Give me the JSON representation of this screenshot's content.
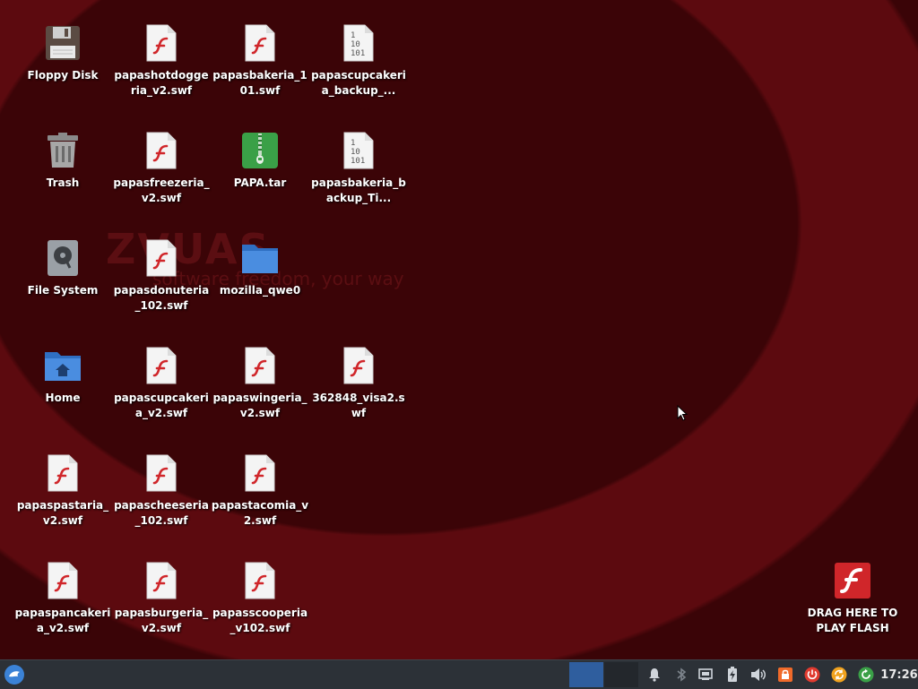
{
  "desktop": {
    "watermark": {
      "logo": "ZVUAS",
      "tagline": "software freedom, your way"
    },
    "icons": [
      {
        "id": "floppy",
        "label": "Floppy Disk",
        "type": "floppy"
      },
      {
        "id": "hotdog",
        "label": "papashotdoggeria_v2.swf",
        "type": "flash"
      },
      {
        "id": "bakeria101",
        "label": "papasbakeria_101.swf",
        "type": "flash"
      },
      {
        "id": "cupcakebackup",
        "label": "papascupcakeria_backup_...",
        "type": "binary"
      },
      {
        "id": "trash",
        "label": "Trash",
        "type": "trash"
      },
      {
        "id": "freezeria",
        "label": "papasfreezeria_v2.swf",
        "type": "flash"
      },
      {
        "id": "papatar",
        "label": "PAPA.tar",
        "type": "archive"
      },
      {
        "id": "bakeriabackup",
        "label": "papasbakeria_backup_Ti...",
        "type": "binary"
      },
      {
        "id": "filesystem",
        "label": "File System",
        "type": "drive"
      },
      {
        "id": "donuteria",
        "label": "papasdonuteria_102.swf",
        "type": "flash"
      },
      {
        "id": "mozilla",
        "label": "mozilla_qwe0",
        "type": "folder"
      },
      {
        "id": "home",
        "label": "Home",
        "type": "home"
      },
      {
        "id": "cupcakeria",
        "label": "papascupcakeria_v2.swf",
        "type": "flash"
      },
      {
        "id": "wingeria",
        "label": "papaswingeria_v2.swf",
        "type": "flash"
      },
      {
        "id": "visa2",
        "label": "362848_visa2.swf",
        "type": "flash"
      },
      {
        "id": "pastaria",
        "label": "papaspastaria_v2.swf",
        "type": "flash"
      },
      {
        "id": "cheeseria",
        "label": "papascheeseria_102.swf",
        "type": "flash"
      },
      {
        "id": "tacomia",
        "label": "papastacomia_v2.swf",
        "type": "flash"
      },
      {
        "id": "pancakeria",
        "label": "papaspancakeria_v2.swf",
        "type": "flash"
      },
      {
        "id": "burgeria",
        "label": "papasburgeria_v2.swf",
        "type": "flash"
      },
      {
        "id": "scooperia",
        "label": "papasscooperia_v102.swf",
        "type": "flash"
      },
      {
        "id": "dragflash",
        "label": "DRAG HERE TO PLAY FLASH",
        "type": "flashapp"
      }
    ]
  },
  "taskbar": {
    "clock": "17:26",
    "tray_icons": [
      "bell-icon",
      "bluetooth-icon",
      "network-icon",
      "battery-icon",
      "volume-icon",
      "lock-icon",
      "power-icon",
      "update-icon",
      "refresh-icon"
    ]
  },
  "colors": {
    "taskbar_bg": "#2c3137",
    "workspace_active": "#2f5e9e",
    "flash_red": "#d0262a"
  }
}
